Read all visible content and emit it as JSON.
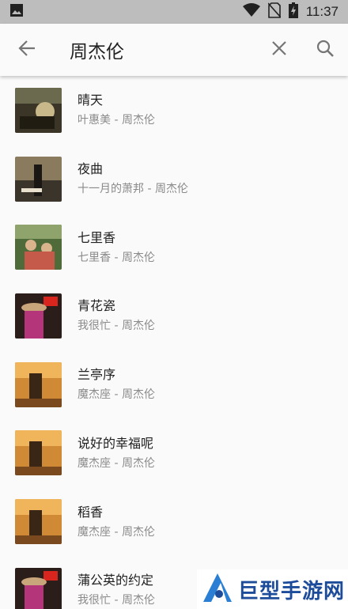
{
  "status_bar": {
    "time": "11:37",
    "icons": [
      "image-notification-icon",
      "wifi-icon",
      "no-sim-icon",
      "battery-charging-icon"
    ]
  },
  "search": {
    "query": "周杰伦",
    "back_icon": "arrow-back-icon",
    "clear_icon": "close-icon",
    "search_icon": "search-icon"
  },
  "songs": [
    {
      "title": "晴天",
      "subtitle": "叶惠美 - 周杰伦"
    },
    {
      "title": "夜曲",
      "subtitle": "十一月的萧邦 - 周杰伦"
    },
    {
      "title": "七里香",
      "subtitle": "七里香 - 周杰伦"
    },
    {
      "title": "青花瓷",
      "subtitle": "我很忙 - 周杰伦"
    },
    {
      "title": "兰亭序",
      "subtitle": "魔杰座 - 周杰伦"
    },
    {
      "title": "说好的幸福呢",
      "subtitle": "魔杰座 - 周杰伦"
    },
    {
      "title": "稻香",
      "subtitle": "魔杰座 - 周杰伦"
    },
    {
      "title": "蒲公英的约定",
      "subtitle": "我很忙 - 周杰伦"
    }
  ],
  "watermark": {
    "text": "巨型手游网"
  },
  "colors": {
    "status_bar": "#bdbdbd",
    "background": "#fafafa",
    "title_text": "#212121",
    "subtitle_text": "#8a8a8a",
    "watermark_blue": "#1d4c9a"
  }
}
